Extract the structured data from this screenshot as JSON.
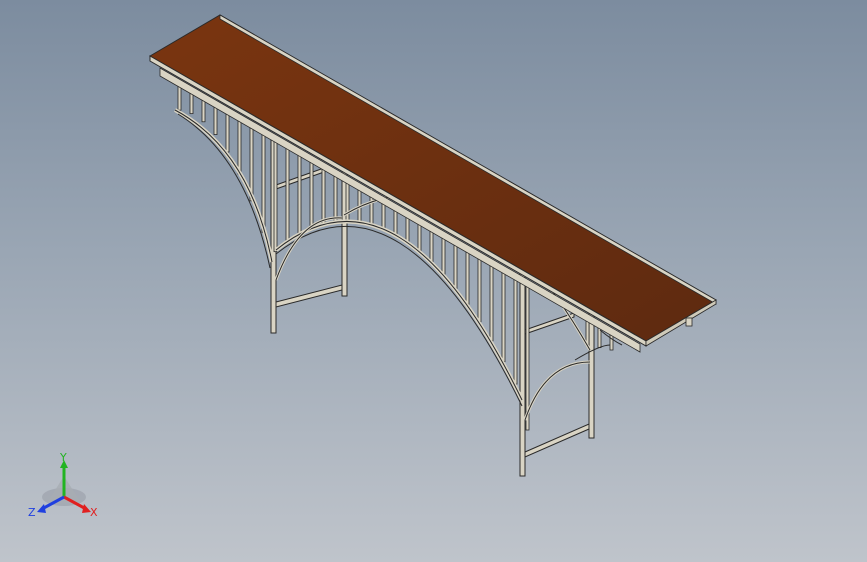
{
  "viewport": {
    "background_top": "#7c8c9f",
    "background_bottom": "#bfc4cb"
  },
  "model": {
    "deck_color": "#6b2e12",
    "frame_color": "#d9d4c4",
    "edge_color": "#2a2a2a"
  },
  "triad": {
    "x_label": "X",
    "y_label": "Y",
    "z_label": "Z",
    "x_color": "#e02020",
    "y_color": "#22b422",
    "z_color": "#2040e0"
  }
}
